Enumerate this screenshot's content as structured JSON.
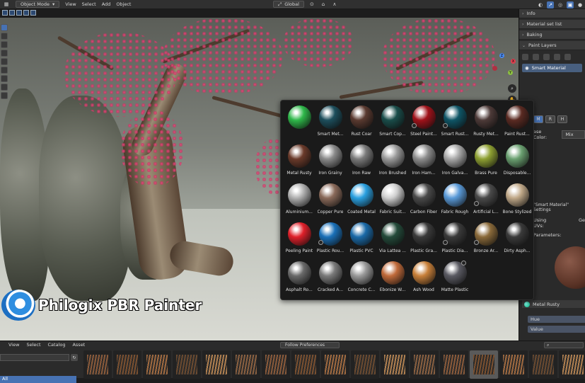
{
  "header": {
    "mode": "Object Mode",
    "menus": [
      "View",
      "Select",
      "Add",
      "Object"
    ],
    "orientation": "Global"
  },
  "branding": {
    "product_name": "Philogix PBR Painter"
  },
  "right_panel": {
    "sections": [
      "Info",
      "Material set list",
      "Baking",
      "Paint Layers"
    ],
    "layer_name": "Smart Material",
    "channels": [
      "M",
      "R",
      "H"
    ],
    "base_color_label": "ase Color:",
    "base_color_mode": "Mix",
    "smart_settings_label": "\"Smart Material\" Settings",
    "using_uvs_label": "Using UVs:",
    "using_uvs_value": "Ge",
    "parameters_label": "Parameters:",
    "material_name": "Metal Rusty",
    "fields": [
      "Hue",
      "Value"
    ]
  },
  "material_picker": {
    "materials": [
      {
        "name": "",
        "color": "#2fb84a",
        "badge": false
      },
      {
        "name": "Smart Met...",
        "color": "#1d4e5c",
        "badge": false
      },
      {
        "name": "Rust Coar",
        "color": "#5a3a30",
        "badge": false
      },
      {
        "name": "Smart Cop...",
        "color": "#1a4d4a",
        "badge": false
      },
      {
        "name": "Steel Paint...",
        "color": "#a0121a",
        "badge": true
      },
      {
        "name": "Smart Rust...",
        "color": "#0f5566",
        "badge": true
      },
      {
        "name": "Rusty Met...",
        "color": "#4d3a38",
        "badge": false
      },
      {
        "name": "Paint Rust...",
        "color": "#5a2a22",
        "badge": false
      },
      {
        "name": "Metal Rusty",
        "color": "#6a3a2a",
        "badge": false
      },
      {
        "name": "Iron Grainy",
        "color": "#8a8a8a",
        "badge": false
      },
      {
        "name": "Iron Raw",
        "color": "#7a7a7a",
        "badge": false
      },
      {
        "name": "Iron Brushed",
        "color": "#9a9a9a",
        "badge": false
      },
      {
        "name": "Iron Ham...",
        "color": "#8d8d8d",
        "badge": false
      },
      {
        "name": "Iron Galva...",
        "color": "#a8a8a8",
        "badge": false
      },
      {
        "name": "Brass Pure",
        "color": "#8ea032",
        "badge": false
      },
      {
        "name": "Disposable...",
        "color": "#6aa070",
        "badge": false
      },
      {
        "name": "Aluminium...",
        "color": "#b0b0b0",
        "badge": false
      },
      {
        "name": "Copper Pure",
        "color": "#8a6a5a",
        "badge": false
      },
      {
        "name": "Coated Metal",
        "color": "#2aa0e0",
        "badge": false
      },
      {
        "name": "Fabric Suit...",
        "color": "#cfcfcf",
        "badge": false
      },
      {
        "name": "Carbon Fiber",
        "color": "#4a4a4a",
        "badge": false
      },
      {
        "name": "Fabric Rough",
        "color": "#5a9ad8",
        "badge": false
      },
      {
        "name": "Artificial L...",
        "color": "#4a4a4a",
        "badge": true
      },
      {
        "name": "Bone Stylized",
        "color": "#c0a888",
        "badge": false
      },
      {
        "name": "Peeling Paint",
        "color": "#e0202a",
        "badge": false
      },
      {
        "name": "Plastic Rou...",
        "color": "#1a70b8",
        "badge": true
      },
      {
        "name": "Plastic PVC",
        "color": "#1a6aa8",
        "badge": false
      },
      {
        "name": "Via Lattea ...",
        "color": "#244a3a",
        "badge": false
      },
      {
        "name": "Plastic Gra...",
        "color": "#3a3a3a",
        "badge": false
      },
      {
        "name": "Plastic Dia...",
        "color": "#3a3a3a",
        "badge": true
      },
      {
        "name": "Bronze Ar...",
        "color": "#8a6a3a",
        "badge": true
      },
      {
        "name": "Dirty Asph...",
        "color": "#3a3a3a",
        "badge": false
      },
      {
        "name": "Asphalt Ro...",
        "color": "#6a6a6a",
        "badge": false
      },
      {
        "name": "Cracked A...",
        "color": "#7a7a7a",
        "badge": false
      },
      {
        "name": "Concrete C...",
        "color": "#9a9a9a",
        "badge": false
      },
      {
        "name": "Ebonize W...",
        "color": "#c06a3a",
        "badge": false
      },
      {
        "name": "Ash Wood",
        "color": "#c8803a",
        "badge": false
      },
      {
        "name": "Matte Plastic",
        "color": "#5a5a62",
        "badge": true
      }
    ]
  },
  "asset_browser": {
    "menus": [
      "View",
      "Select",
      "Catalog",
      "Asset"
    ],
    "library": "Follow Preferences",
    "catalog_all": "All",
    "thumb_count": 17
  }
}
